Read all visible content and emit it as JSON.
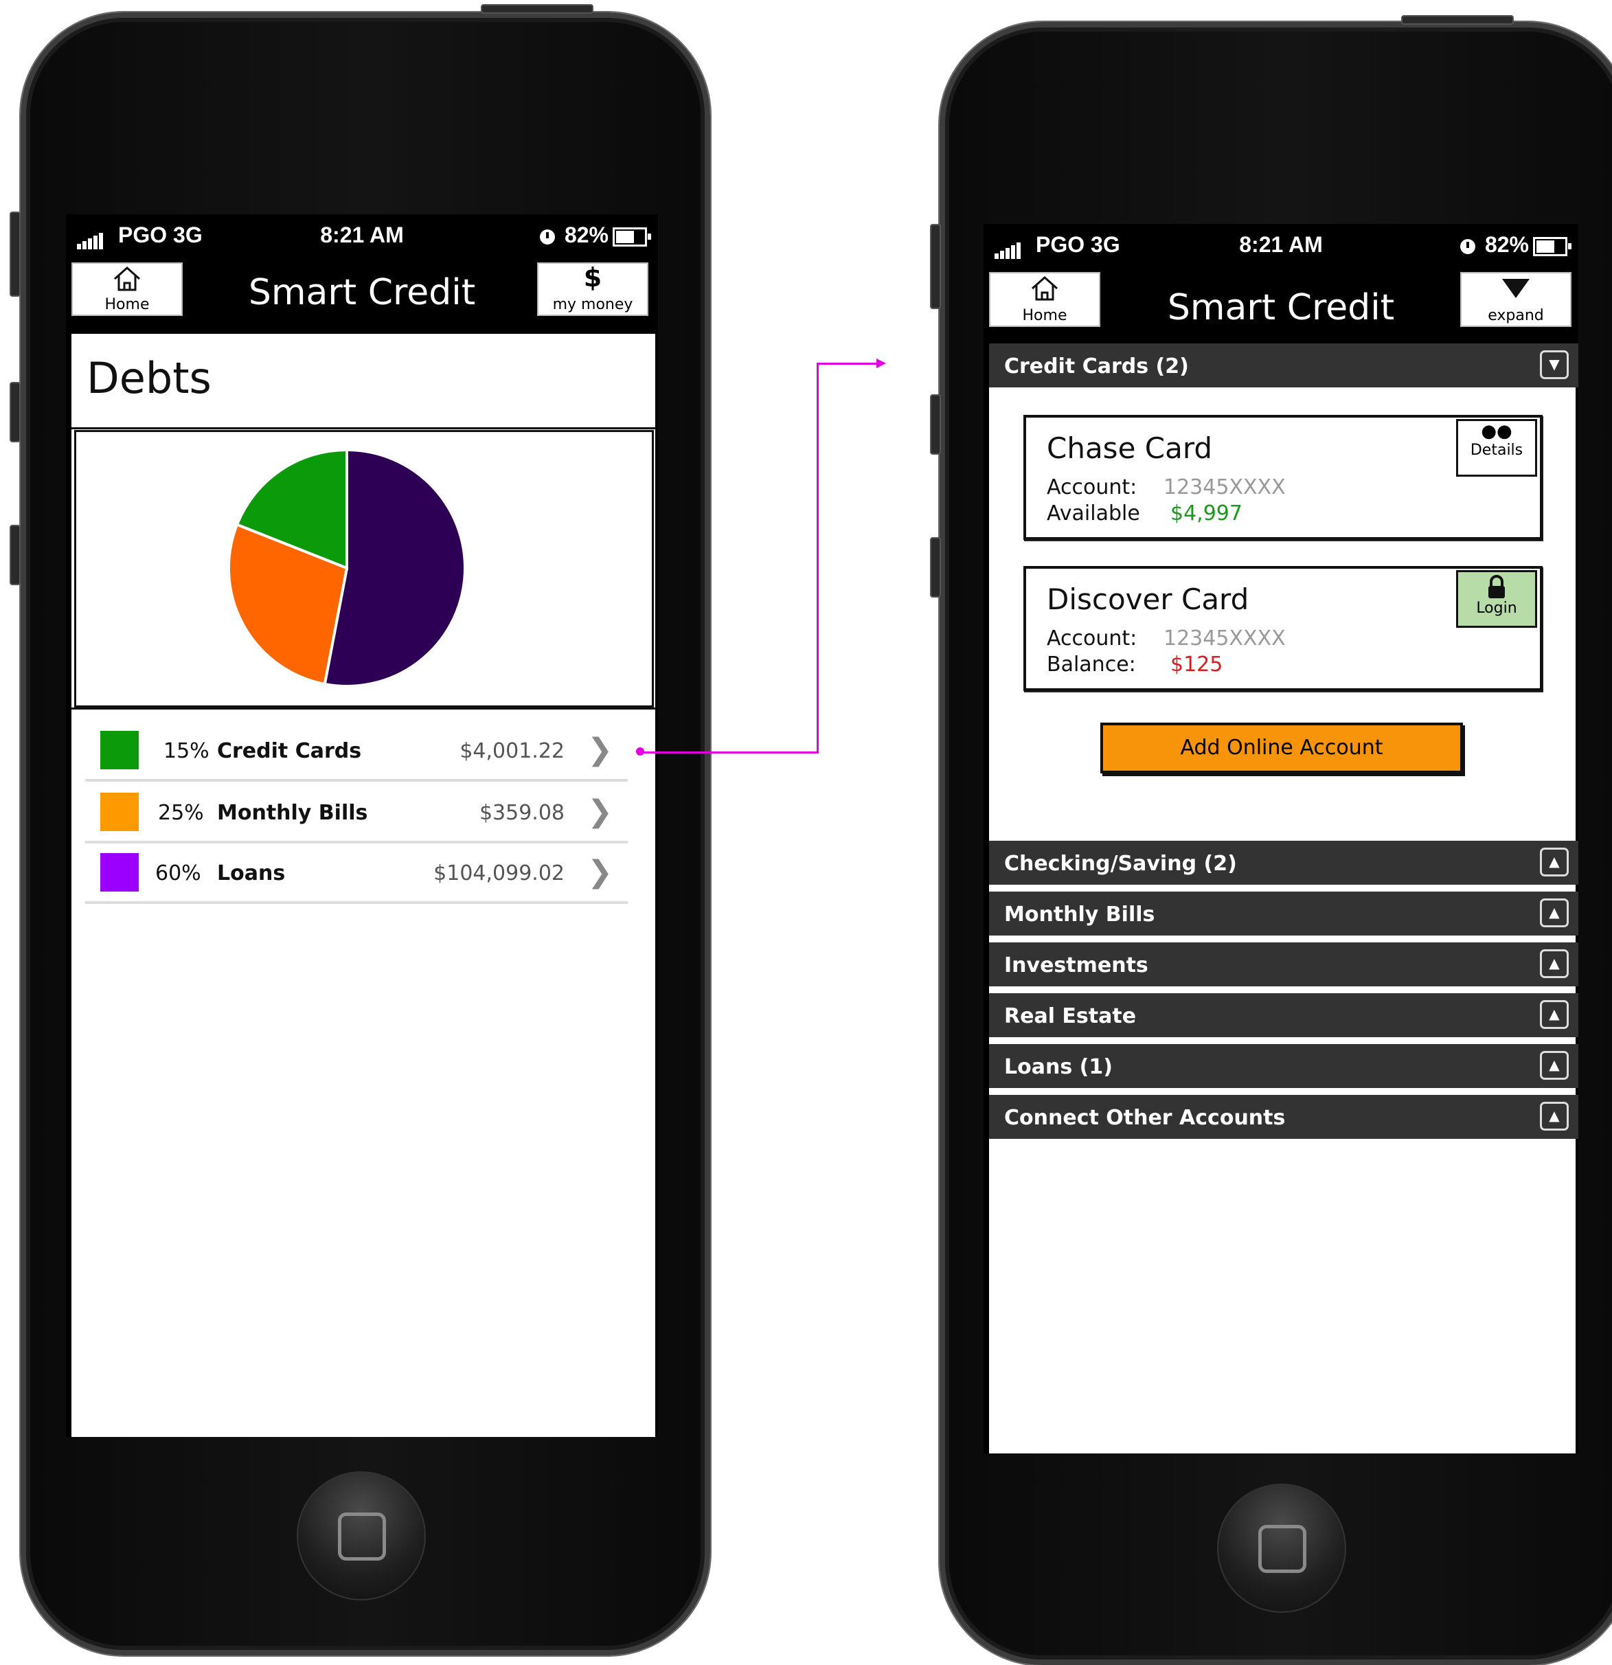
{
  "status": {
    "carrier": "PGO 3G",
    "time": "8:21 AM",
    "battery": "82%"
  },
  "app": {
    "title": "Smart Credit",
    "home_label": "Home",
    "my_money_label": "my money",
    "my_money_glyph": "$",
    "expand_label": "expand"
  },
  "debts": {
    "heading": "Debts",
    "rows": [
      {
        "pct": "15%",
        "label": "Credit Cards",
        "amount": "$4,001.22",
        "color": "#0a9a0a"
      },
      {
        "pct": "25%",
        "label": "Monthly Bills",
        "amount": "$359.08",
        "color": "#ff9900"
      },
      {
        "pct": "60%",
        "label": "Loans",
        "amount": "$104,099.02",
        "color": "#9b00ff"
      }
    ]
  },
  "chart_data": {
    "type": "pie",
    "slices": [
      {
        "value": 53,
        "color": "#2d0055"
      },
      {
        "value": 28,
        "color": "#ff6600"
      },
      {
        "value": 19,
        "color": "#0a9a0a"
      }
    ]
  },
  "accounts": {
    "sections": [
      {
        "title": "Credit Cards (2)",
        "toggle": "▼"
      },
      {
        "title": "Checking/Saving (2)",
        "toggle": "▲"
      },
      {
        "title": "Monthly Bills",
        "toggle": "▲"
      },
      {
        "title": "Investments",
        "toggle": "▲"
      },
      {
        "title": "Real Estate",
        "toggle": "▲"
      },
      {
        "title": "Loans (1)",
        "toggle": "▲"
      },
      {
        "title": "Connect Other Accounts",
        "toggle": "▲"
      }
    ],
    "cards": [
      {
        "name": "Chase Card",
        "k1": "Account:",
        "v1": "12345XXXX",
        "k2": "Available",
        "v2": "$4,997",
        "v2_color": "#1a9a1a",
        "action": "Details"
      },
      {
        "name": "Discover Card",
        "k1": "Account:",
        "v1": "12345XXXX",
        "k2": "Balance:",
        "v2": "$125",
        "v2_color": "#d42020",
        "action": "Login"
      }
    ],
    "add_button": "Add Online Account"
  },
  "colors": {
    "connector": "#e000e0",
    "login_bg": "#b8dca8"
  }
}
